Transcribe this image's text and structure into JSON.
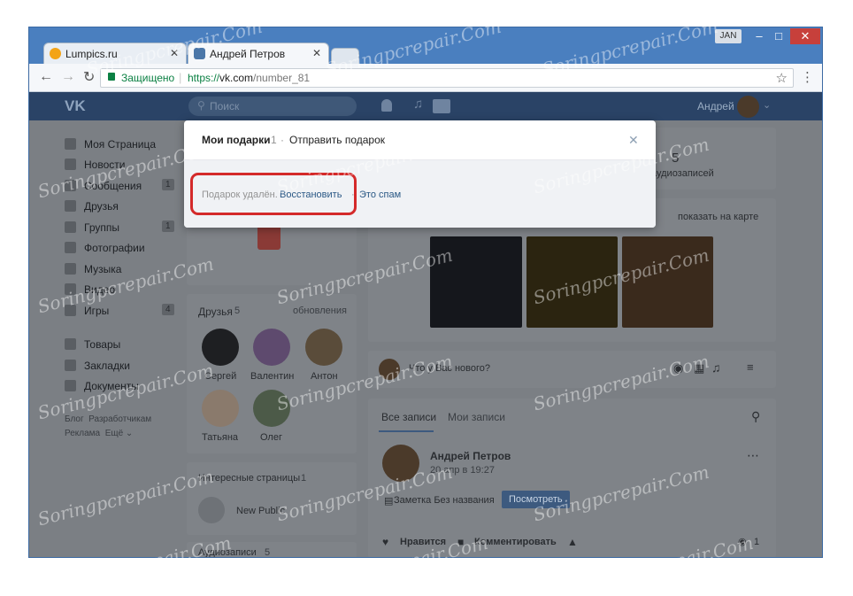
{
  "browser": {
    "profile_badge": "JAN",
    "tabs": [
      {
        "title": "Lumpics.ru",
        "close": "✕"
      },
      {
        "title": "Андрей Петров",
        "close": "✕"
      }
    ],
    "secure_label": "Защищено",
    "url_prefix": "https://",
    "url_host": "vk.com",
    "url_path": "/number_81"
  },
  "vk": {
    "search_placeholder": "Поиск",
    "user_name": "Андрей",
    "menu": [
      {
        "label": "Моя Страница",
        "count": ""
      },
      {
        "label": "Новости",
        "count": ""
      },
      {
        "label": "Сообщения",
        "count": "1"
      },
      {
        "label": "Друзья",
        "count": ""
      },
      {
        "label": "Группы",
        "count": "1"
      },
      {
        "label": "Фотографии",
        "count": ""
      },
      {
        "label": "Музыка",
        "count": ""
      },
      {
        "label": "Видео",
        "count": ""
      },
      {
        "label": "Игры",
        "count": "4"
      },
      {
        "label": "Товары",
        "count": ""
      },
      {
        "label": "Закладки",
        "count": ""
      },
      {
        "label": "Документы",
        "count": ""
      }
    ],
    "footer_links": [
      "Блог",
      "Разработчикам",
      "Реклама",
      "Ещё ⌄"
    ],
    "friends": {
      "title": "Друзья",
      "count": "5",
      "updates": "обновления",
      "people": [
        "Сергей",
        "Валентин",
        "Антон",
        "Татьяна",
        "Олег"
      ]
    },
    "interesting": {
      "title": "Интересные страницы",
      "count": "1",
      "item": "New Public"
    },
    "audio": {
      "title": "Аудиозаписи",
      "count": "5"
    },
    "stats": {
      "number": "5",
      "label": "аудиозаписей"
    },
    "map_link": "показать на карте",
    "composer_placeholder": "Что у Вас нового?",
    "wall": {
      "tab_all": "Все записи",
      "tab_mine": "Мои записи",
      "post_author": "Андрей Петров",
      "post_date": "20 апр в 19:27",
      "note_label": "Заметка Без названия",
      "view_button": "Посмотреть",
      "like": "Нравится",
      "comment": "Комментировать",
      "views": "1"
    }
  },
  "modal": {
    "title": "Мои подарки",
    "count": "1",
    "sep": "·",
    "send_link": "Отправить подарок",
    "close": "✕",
    "deleted_text": "Подарок удалён.",
    "restore_link": "Восстановить",
    "dot": "·",
    "spam_link": "Это спам"
  },
  "watermark": "Soringpcrepair.Com",
  "colors": {
    "vk_header": "#2a4366",
    "link": "#2a5885",
    "highlight": "#d42a2a"
  }
}
